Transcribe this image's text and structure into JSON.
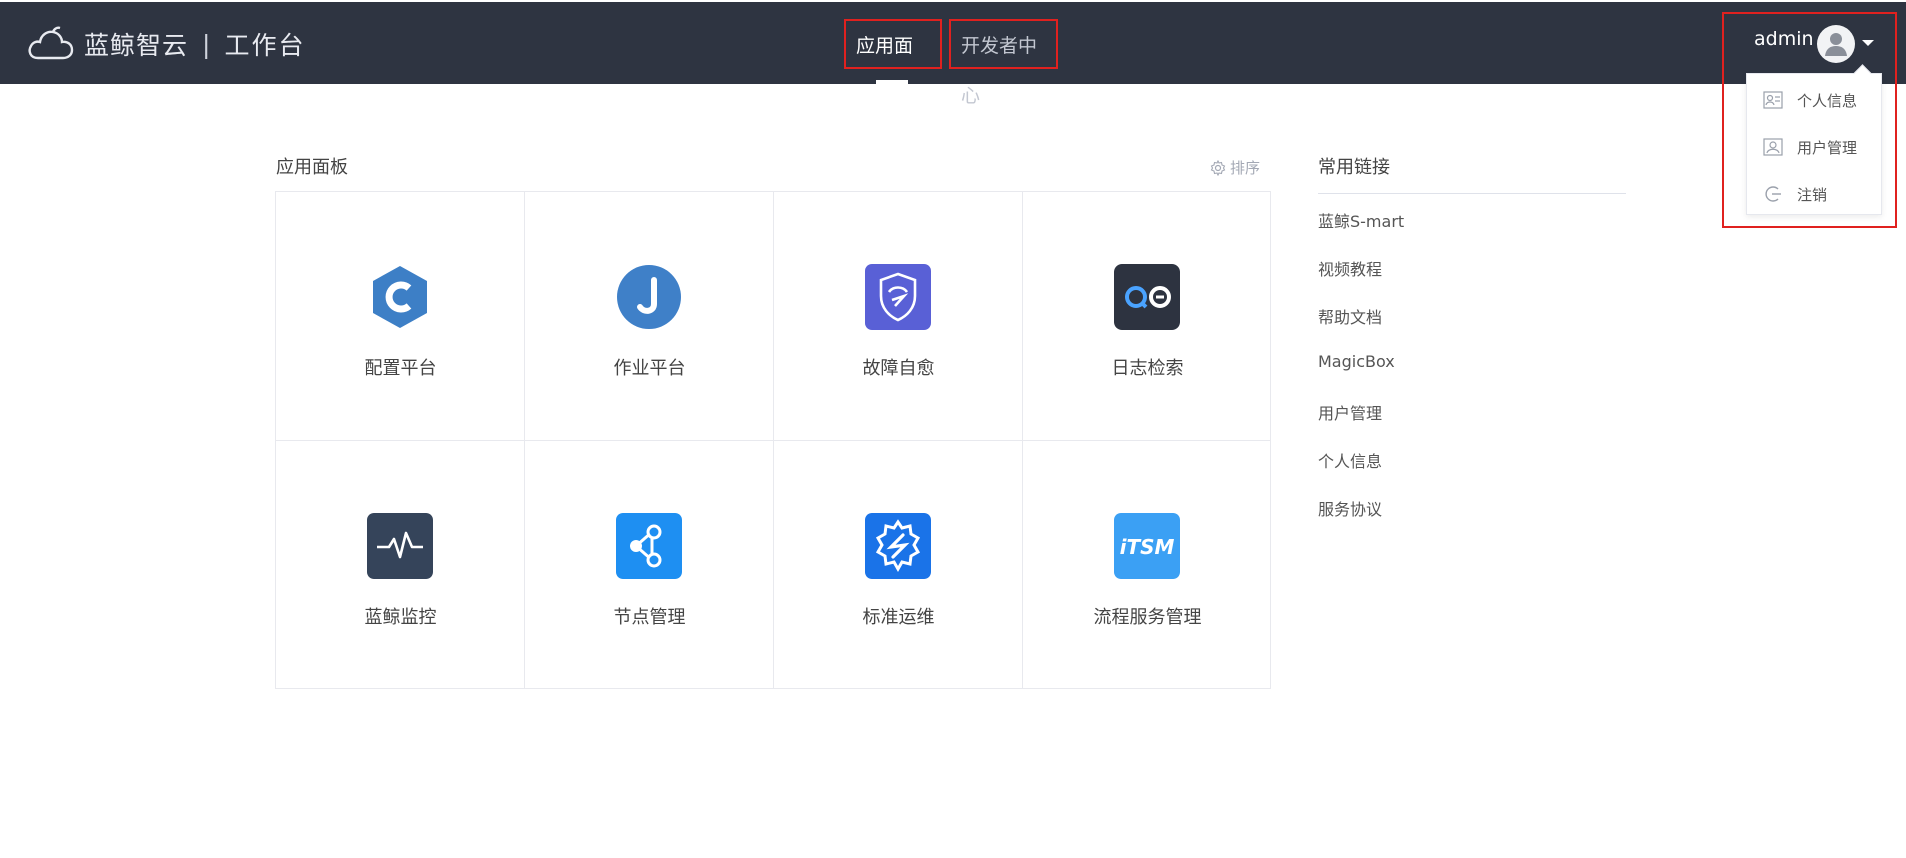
{
  "header": {
    "brand_name": "蓝鲸智云",
    "brand_sep": "|",
    "brand_sub": "工作台",
    "nav": [
      {
        "label": "应用面板",
        "active": true
      },
      {
        "label": "开发者中心",
        "active": false
      }
    ],
    "user": {
      "name": "admin",
      "menu": [
        {
          "label": "个人信息",
          "icon": "id-card-icon"
        },
        {
          "label": "用户管理",
          "icon": "user-card-icon"
        },
        {
          "label": "注销",
          "icon": "logout-icon"
        }
      ]
    }
  },
  "panel": {
    "title": "应用面板",
    "sort_label": "排序",
    "apps": [
      {
        "label": "配置平台",
        "icon": "config-platform-icon",
        "color": "#3d7fc6"
      },
      {
        "label": "作业平台",
        "icon": "job-platform-icon",
        "color": "#3f80c8"
      },
      {
        "label": "故障自愈",
        "icon": "fault-selfheal-icon",
        "color": "#5960d6"
      },
      {
        "label": "日志检索",
        "icon": "log-search-icon",
        "color": "#2d3340"
      },
      {
        "label": "蓝鲸监控",
        "icon": "monitor-icon",
        "color": "#35445a"
      },
      {
        "label": "节点管理",
        "icon": "node-manage-icon",
        "color": "#1e8ff2"
      },
      {
        "label": "标准运维",
        "icon": "standard-ops-icon",
        "color": "#1a73e8"
      },
      {
        "label": "流程服务管理",
        "icon": "itsm-icon",
        "color": "#3ba0f4"
      }
    ]
  },
  "links": {
    "title": "常用链接",
    "items": [
      "蓝鲸S-mart",
      "视频教程",
      "帮助文档",
      "MagicBox",
      "用户管理",
      "个人信息",
      "服务协议"
    ]
  }
}
